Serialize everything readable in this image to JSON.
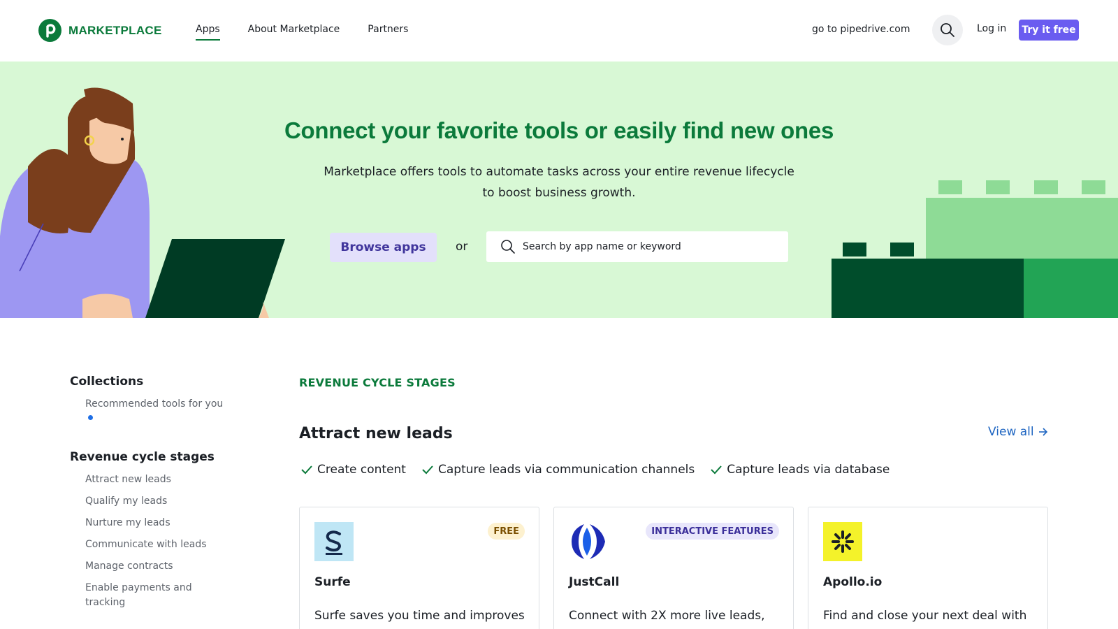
{
  "header": {
    "logo_text": "MARKETPLACE",
    "nav": [
      {
        "label": "Apps",
        "active": true
      },
      {
        "label": "About Marketplace",
        "active": false
      },
      {
        "label": "Partners",
        "active": false
      }
    ],
    "goto_label": "go to pipedrive.com",
    "login_label": "Log in",
    "try_label": "Try it free"
  },
  "hero": {
    "title": "Connect your favorite tools or easily find new ones",
    "subtitle_line1": "Marketplace offers tools to automate tasks across your entire revenue lifecycle",
    "subtitle_line2": "to boost business growth.",
    "browse_label": "Browse apps",
    "or_label": "or",
    "search_placeholder": "Search by app name or keyword"
  },
  "sidebar": {
    "collections_heading": "Collections",
    "collections": [
      {
        "label": "Recommended tools for you"
      }
    ],
    "stages_heading": "Revenue cycle stages",
    "stages": [
      {
        "label": "Attract new leads"
      },
      {
        "label": "Qualify my leads"
      },
      {
        "label": "Nurture my leads"
      },
      {
        "label": "Communicate with leads"
      },
      {
        "label": "Manage contracts"
      },
      {
        "label": "Enable payments and tracking"
      }
    ]
  },
  "main": {
    "section_label": "REVENUE CYCLE STAGES",
    "section_title": "Attract new leads",
    "view_all": "View all",
    "checks": [
      {
        "label": "Create content"
      },
      {
        "label": "Capture leads via communication channels"
      },
      {
        "label": "Capture leads via database"
      }
    ],
    "cards": [
      {
        "name": "Surfe",
        "badge": "FREE",
        "description": "Surfe saves you time and improves"
      },
      {
        "name": "JustCall",
        "badge": "INTERACTIVE FEATURES",
        "description": "Connect with 2X more live leads,"
      },
      {
        "name": "Apollo.io",
        "badge": "",
        "description": "Find and close your next deal with"
      }
    ]
  },
  "colors": {
    "brand_green": "#0b7a3b",
    "hero_bg": "#d8f8d5",
    "accent_purple": "#6a5cf0",
    "link_blue": "#1f66c2"
  }
}
